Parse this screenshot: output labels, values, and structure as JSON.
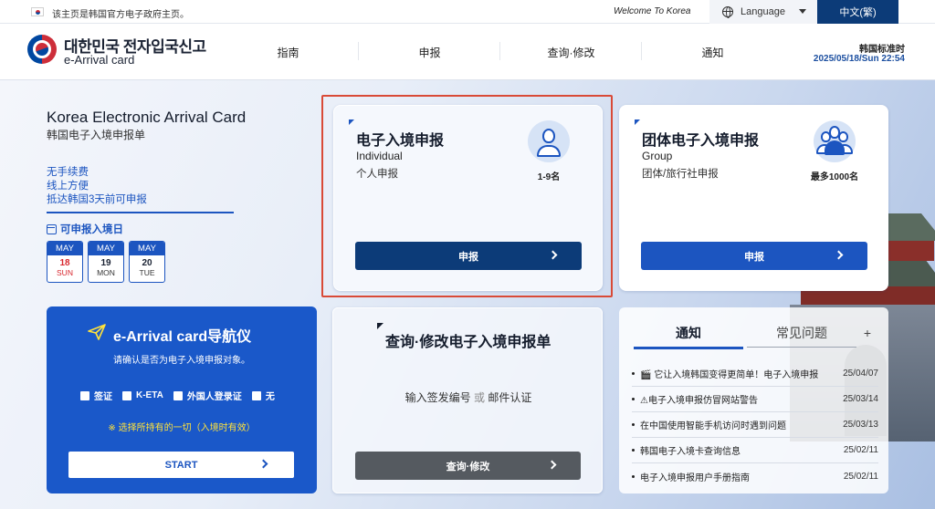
{
  "topbar": {
    "gov_notice": "该主页是韩国官方电子政府主页。",
    "welcome": "Welcome To Korea",
    "language_label": "Language",
    "current_language": "中文(繁)"
  },
  "header": {
    "logo_korean": "대한민국 전자입국신고",
    "logo_english": "e-Arrival card",
    "nav": [
      "指南",
      "申报",
      "查询·修改",
      "通知"
    ],
    "time_label": "韩国标准时",
    "time_value": "2025/05/18/Sun 22:54"
  },
  "intro": {
    "title": "Korea Electronic Arrival Card",
    "subtitle": "韩国电子入境申报单",
    "benefits": [
      "无手续费",
      "线上方便",
      "抵达韩国3天前可申报"
    ],
    "dates_label": "可申报入境日",
    "dates": [
      {
        "month": "MAY",
        "day": "18",
        "weekday": "SUN",
        "today": true
      },
      {
        "month": "MAY",
        "day": "19",
        "weekday": "MON",
        "today": false
      },
      {
        "month": "MAY",
        "day": "20",
        "weekday": "TUE",
        "today": false
      }
    ]
  },
  "individual": {
    "title": "电子入境申报",
    "english": "Individual",
    "desc": "个人申报",
    "count": "1-9名",
    "button": "申报"
  },
  "group": {
    "title": "团体电子入境申报",
    "english": "Group",
    "desc": "团体/旅行社申报",
    "count": "最多1000名",
    "button": "申报"
  },
  "navigator": {
    "title": "e-Arrival card导航仪",
    "subtitle": "请确认是否为电子入境申报对象。",
    "options": [
      "签证",
      "K-ETA",
      "外国人登录证",
      "无"
    ],
    "note": "※ 选择所持有的一切（入境时有效）",
    "start": "START"
  },
  "inquiry": {
    "title": "查询·修改电子入境申报单",
    "desc_part1": "输入签发编号",
    "desc_or": "或",
    "desc_part2": "邮件认证",
    "button": "查询·修改"
  },
  "notices": {
    "tab_notice": "通知",
    "tab_faq": "常见问题",
    "more": "+",
    "items": [
      {
        "title": "🎬 它让入境韩国变得更简单！电子入境申报",
        "date": "25/04/07"
      },
      {
        "title": "⚠电子入境申报仿冒网站警告",
        "date": "25/03/14"
      },
      {
        "title": "在中国使用智能手机访问时遇到问题",
        "date": "25/03/13"
      },
      {
        "title": "韩国电子入境卡查询信息",
        "date": "25/02/11"
      },
      {
        "title": "电子入境申报用户手册指南",
        "date": "25/02/11"
      }
    ]
  }
}
